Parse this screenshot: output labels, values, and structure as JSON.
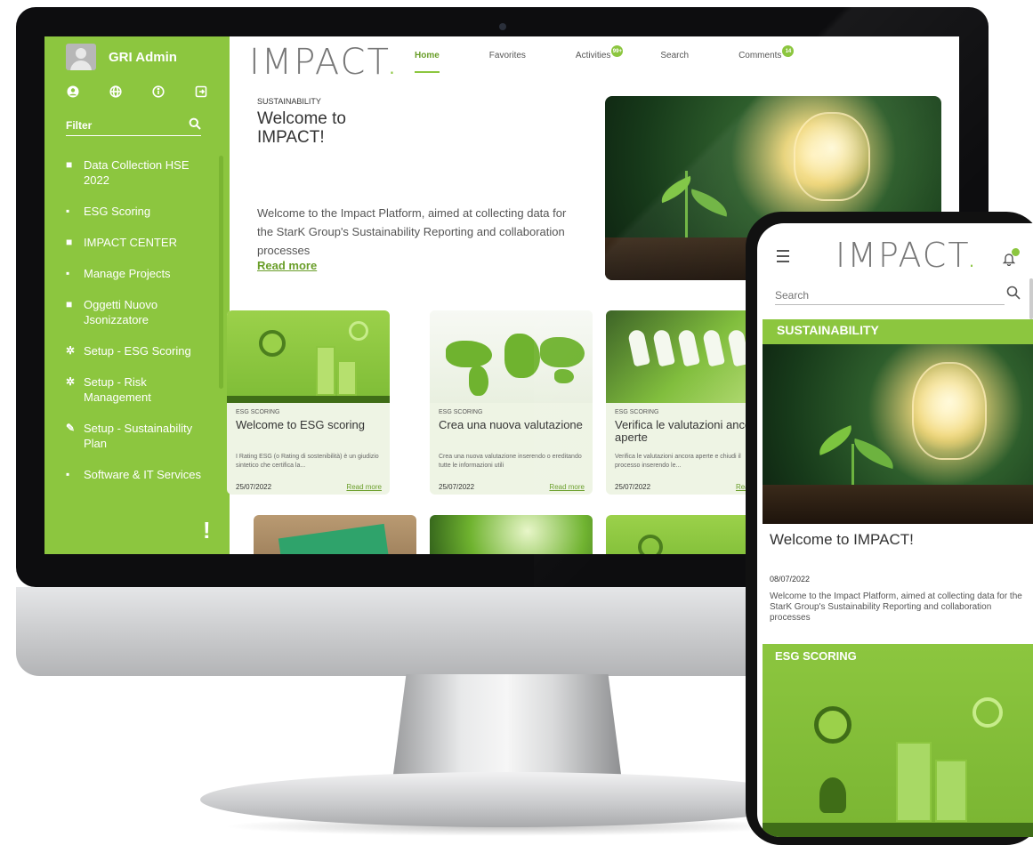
{
  "desktop": {
    "sidebar": {
      "user_name": "GRI Admin",
      "icons": [
        "account-icon",
        "globe-icon",
        "info-icon",
        "logout-icon"
      ],
      "filter_label": "Filter",
      "items": [
        {
          "label": "Data Collection HSE 2022",
          "icon": "document-icon"
        },
        {
          "label": "ESG Scoring",
          "icon": "chart-icon"
        },
        {
          "label": "IMPACT CENTER",
          "icon": "document-icon"
        },
        {
          "label": "Manage Projects",
          "icon": "chart-icon"
        },
        {
          "label": "Oggetti Nuovo Jsonizzatore",
          "icon": "document-icon"
        },
        {
          "label": "Setup - ESG Scoring",
          "icon": "settings-icon"
        },
        {
          "label": "Setup - Risk Management",
          "icon": "settings-icon"
        },
        {
          "label": "Setup - Sustainability Plan",
          "icon": "wrench-icon"
        },
        {
          "label": "Software & IT Services",
          "icon": "chart-icon"
        }
      ]
    },
    "header": {
      "logo": "IMPACT",
      "logo_dot": ".",
      "nav": {
        "home": "Home",
        "favorites": "Favorites",
        "activities": "Activities",
        "activities_badge": "99+",
        "search": "Search",
        "comments": "Comments",
        "comments_badge": "14"
      }
    },
    "hero": {
      "category": "SUSTAINABILITY",
      "title": "Welcome to IMPACT!",
      "text": "Welcome to the Impact Platform, aimed at collecting data for the StarK Group's Sustainability Reporting and collaboration processes",
      "read_more": "Read more"
    },
    "cards": [
      {
        "category": "ESG SCORING",
        "title": "Welcome to ESG scoring",
        "desc": "I Rating ESG (o Rating di sostenibilità) è un giudizio sintetico che certifica la...",
        "date": "25/07/2022",
        "read_more": "Read more"
      },
      {
        "category": "ESG SCORING",
        "title": "Crea una nuova valutazione",
        "desc": "Crea una nuova valutazione inserendo o ereditando tutte le informazioni utili",
        "date": "25/07/2022",
        "read_more": "Read more"
      },
      {
        "category": "ESG SCORING",
        "title": "Verifica le valutazioni ancora aperte",
        "desc": "Verifica le valutazioni ancora aperte e chiudi il processo inserendo le...",
        "date": "25/07/2022",
        "read_more": "Read m"
      }
    ]
  },
  "mobile": {
    "logo": "IMPACT",
    "logo_dot": ".",
    "search_placeholder": "Search",
    "section1": "SUSTAINABILITY",
    "title": "Welcome to IMPACT!",
    "date": "08/07/2022",
    "text": "Welcome to the Impact Platform, aimed at collecting data for the StarK Group's Sustainability Reporting and collaboration processes",
    "section2": "ESG SCORING"
  },
  "colors": {
    "brand_green": "#8cc63f",
    "link_green": "#6a9e2a",
    "text": "#333333"
  }
}
